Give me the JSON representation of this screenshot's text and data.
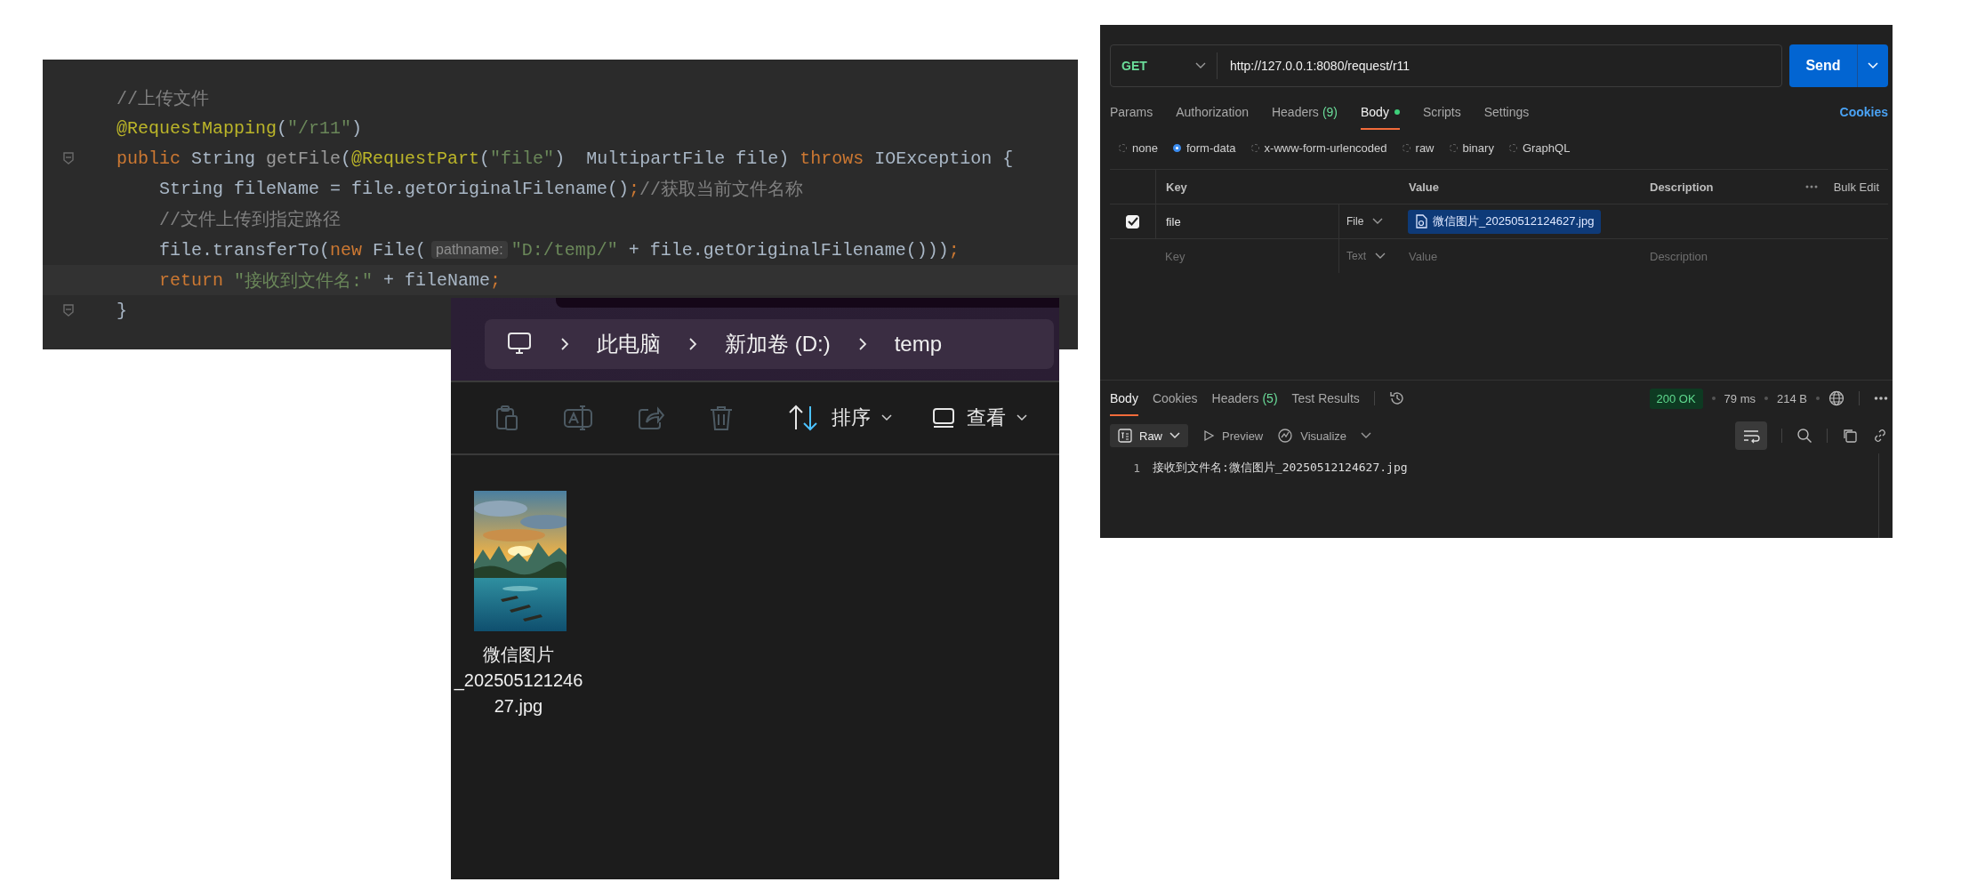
{
  "code_editor": {
    "lines": [
      {
        "fold": false,
        "current": false,
        "tokens": [
          {
            "kind": "comment",
            "text": "//上传文件"
          }
        ]
      },
      {
        "fold": false,
        "current": false,
        "tokens": [
          {
            "kind": "annotation",
            "text": "@RequestMapping"
          },
          {
            "kind": "plain",
            "text": "("
          },
          {
            "kind": "string",
            "text": "\"/r11\""
          },
          {
            "kind": "plain",
            "text": ")"
          }
        ]
      },
      {
        "fold": true,
        "current": false,
        "tokens": [
          {
            "kind": "keyword",
            "text": "public "
          },
          {
            "kind": "plain",
            "text": "String "
          },
          {
            "kind": "unused",
            "text": "getFile"
          },
          {
            "kind": "plain",
            "text": "("
          },
          {
            "kind": "annotation",
            "text": "@RequestPart"
          },
          {
            "kind": "plain",
            "text": "("
          },
          {
            "kind": "string",
            "text": "\"file\""
          },
          {
            "kind": "plain",
            "text": ")  MultipartFile file) "
          },
          {
            "kind": "keyword",
            "text": "throws "
          },
          {
            "kind": "plain",
            "text": "IOException {"
          }
        ]
      },
      {
        "fold": false,
        "current": false,
        "tokens": [
          {
            "kind": "plain",
            "text": "    String fileName = file.getOriginalFilename()"
          },
          {
            "kind": "keyword",
            "text": ";"
          },
          {
            "kind": "comment",
            "text": "//获取当前文件名称"
          }
        ]
      },
      {
        "fold": false,
        "current": false,
        "tokens": [
          {
            "kind": "comment",
            "text": "    //文件上传到指定路径"
          }
        ]
      },
      {
        "fold": false,
        "current": false,
        "tokens": [
          {
            "kind": "plain",
            "text": "    file.transferTo("
          },
          {
            "kind": "keyword",
            "text": "new "
          },
          {
            "kind": "plain",
            "text": "File("
          },
          {
            "kind": "hint",
            "text": "pathname:"
          },
          {
            "kind": "string",
            "text": "\"D:/temp/\""
          },
          {
            "kind": "plain",
            "text": " + file.getOriginalFilename()))"
          },
          {
            "kind": "keyword",
            "text": ";"
          }
        ]
      },
      {
        "fold": false,
        "current": true,
        "tokens": [
          {
            "kind": "keyword",
            "text": "    return "
          },
          {
            "kind": "string",
            "text": "\"接收到文件名:\""
          },
          {
            "kind": "plain",
            "text": " + fileName"
          },
          {
            "kind": "keyword",
            "text": ";"
          }
        ]
      },
      {
        "fold": true,
        "current": false,
        "tokens": [
          {
            "kind": "plain",
            "text": "}"
          }
        ]
      }
    ]
  },
  "file_explorer": {
    "breadcrumb": [
      "此电脑",
      "新加卷 (D:)",
      "temp"
    ],
    "actions": [
      {
        "kind": "paste",
        "disabled": true
      },
      {
        "kind": "rename",
        "disabled": true
      },
      {
        "kind": "share",
        "disabled": true
      },
      {
        "kind": "delete",
        "disabled": true
      }
    ],
    "sort": {
      "label": "排序"
    },
    "view": {
      "label": "查看"
    },
    "items": [
      {
        "kind": "picture",
        "name_lines": [
          "微信图片",
          "_202505121246",
          "27.jpg"
        ]
      }
    ]
  },
  "postman": {
    "method": "GET",
    "url": "http://127.0.0.1:8080/request/r11",
    "send": "Send",
    "request_tabs": [
      {
        "label": "Params",
        "selected": false,
        "dot": false
      },
      {
        "label": "Authorization",
        "selected": false,
        "dot": false
      },
      {
        "label": "Headers",
        "count": "(9)",
        "selected": false,
        "dot": false
      },
      {
        "label": "Body",
        "selected": true,
        "dot": true
      },
      {
        "label": "Scripts",
        "selected": false,
        "dot": false
      },
      {
        "label": "Settings",
        "selected": false,
        "dot": false
      }
    ],
    "cookies": "Cookies",
    "body_types": [
      {
        "label": "none",
        "selected": false
      },
      {
        "label": "form-data",
        "selected": true
      },
      {
        "label": "x-www-form-urlencoded",
        "selected": false
      },
      {
        "label": "raw",
        "selected": false
      },
      {
        "label": "binary",
        "selected": false
      },
      {
        "label": "GraphQL",
        "selected": false
      }
    ],
    "columns": [
      "Key",
      "Value",
      "Description"
    ],
    "bulk_edit": "Bulk Edit",
    "rows": [
      {
        "checked": true,
        "key": "file",
        "type": "File",
        "value": "微信图片_20250512124627.jpg"
      }
    ],
    "new_row": {
      "key": {
        "placeholder": "Key"
      },
      "type": "Text",
      "value": {
        "placeholder": "Value"
      },
      "description": {
        "placeholder": "Description"
      }
    },
    "response_tabs": [
      {
        "label": "Body",
        "selected": true
      },
      {
        "label": "Cookies",
        "selected": false
      },
      {
        "label": "Headers",
        "count": "(5)",
        "selected": false
      },
      {
        "label": "Test Results",
        "selected": false
      }
    ],
    "status": "200 OK",
    "time": "79 ms",
    "size": "214 B",
    "format": "Raw",
    "views": [
      "Preview",
      "Visualize"
    ],
    "response_lines": [
      {
        "number": "1",
        "text": "接收到文件名:微信图片_20250512124627.jpg"
      }
    ]
  }
}
